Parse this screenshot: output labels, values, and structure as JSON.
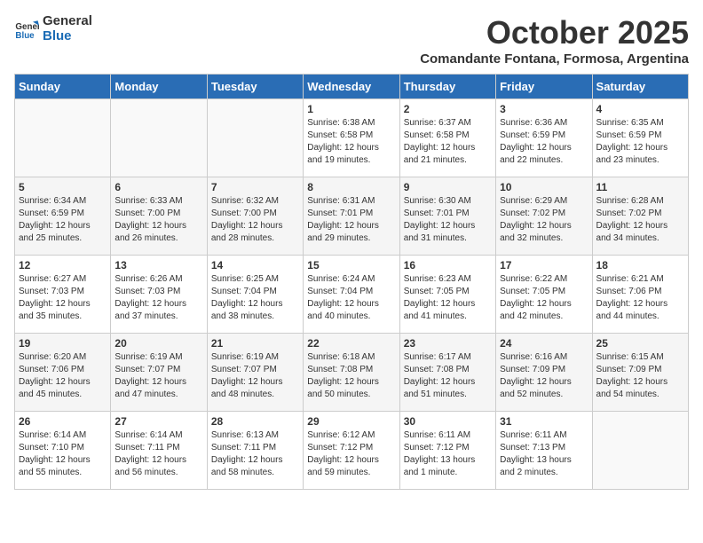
{
  "logo": {
    "line1": "General",
    "line2": "Blue"
  },
  "title": "October 2025",
  "subtitle": "Comandante Fontana, Formosa, Argentina",
  "weekdays": [
    "Sunday",
    "Monday",
    "Tuesday",
    "Wednesday",
    "Thursday",
    "Friday",
    "Saturday"
  ],
  "weeks": [
    [
      {
        "day": "",
        "info": ""
      },
      {
        "day": "",
        "info": ""
      },
      {
        "day": "",
        "info": ""
      },
      {
        "day": "1",
        "info": "Sunrise: 6:38 AM\nSunset: 6:58 PM\nDaylight: 12 hours\nand 19 minutes."
      },
      {
        "day": "2",
        "info": "Sunrise: 6:37 AM\nSunset: 6:58 PM\nDaylight: 12 hours\nand 21 minutes."
      },
      {
        "day": "3",
        "info": "Sunrise: 6:36 AM\nSunset: 6:59 PM\nDaylight: 12 hours\nand 22 minutes."
      },
      {
        "day": "4",
        "info": "Sunrise: 6:35 AM\nSunset: 6:59 PM\nDaylight: 12 hours\nand 23 minutes."
      }
    ],
    [
      {
        "day": "5",
        "info": "Sunrise: 6:34 AM\nSunset: 6:59 PM\nDaylight: 12 hours\nand 25 minutes."
      },
      {
        "day": "6",
        "info": "Sunrise: 6:33 AM\nSunset: 7:00 PM\nDaylight: 12 hours\nand 26 minutes."
      },
      {
        "day": "7",
        "info": "Sunrise: 6:32 AM\nSunset: 7:00 PM\nDaylight: 12 hours\nand 28 minutes."
      },
      {
        "day": "8",
        "info": "Sunrise: 6:31 AM\nSunset: 7:01 PM\nDaylight: 12 hours\nand 29 minutes."
      },
      {
        "day": "9",
        "info": "Sunrise: 6:30 AM\nSunset: 7:01 PM\nDaylight: 12 hours\nand 31 minutes."
      },
      {
        "day": "10",
        "info": "Sunrise: 6:29 AM\nSunset: 7:02 PM\nDaylight: 12 hours\nand 32 minutes."
      },
      {
        "day": "11",
        "info": "Sunrise: 6:28 AM\nSunset: 7:02 PM\nDaylight: 12 hours\nand 34 minutes."
      }
    ],
    [
      {
        "day": "12",
        "info": "Sunrise: 6:27 AM\nSunset: 7:03 PM\nDaylight: 12 hours\nand 35 minutes."
      },
      {
        "day": "13",
        "info": "Sunrise: 6:26 AM\nSunset: 7:03 PM\nDaylight: 12 hours\nand 37 minutes."
      },
      {
        "day": "14",
        "info": "Sunrise: 6:25 AM\nSunset: 7:04 PM\nDaylight: 12 hours\nand 38 minutes."
      },
      {
        "day": "15",
        "info": "Sunrise: 6:24 AM\nSunset: 7:04 PM\nDaylight: 12 hours\nand 40 minutes."
      },
      {
        "day": "16",
        "info": "Sunrise: 6:23 AM\nSunset: 7:05 PM\nDaylight: 12 hours\nand 41 minutes."
      },
      {
        "day": "17",
        "info": "Sunrise: 6:22 AM\nSunset: 7:05 PM\nDaylight: 12 hours\nand 42 minutes."
      },
      {
        "day": "18",
        "info": "Sunrise: 6:21 AM\nSunset: 7:06 PM\nDaylight: 12 hours\nand 44 minutes."
      }
    ],
    [
      {
        "day": "19",
        "info": "Sunrise: 6:20 AM\nSunset: 7:06 PM\nDaylight: 12 hours\nand 45 minutes."
      },
      {
        "day": "20",
        "info": "Sunrise: 6:19 AM\nSunset: 7:07 PM\nDaylight: 12 hours\nand 47 minutes."
      },
      {
        "day": "21",
        "info": "Sunrise: 6:19 AM\nSunset: 7:07 PM\nDaylight: 12 hours\nand 48 minutes."
      },
      {
        "day": "22",
        "info": "Sunrise: 6:18 AM\nSunset: 7:08 PM\nDaylight: 12 hours\nand 50 minutes."
      },
      {
        "day": "23",
        "info": "Sunrise: 6:17 AM\nSunset: 7:08 PM\nDaylight: 12 hours\nand 51 minutes."
      },
      {
        "day": "24",
        "info": "Sunrise: 6:16 AM\nSunset: 7:09 PM\nDaylight: 12 hours\nand 52 minutes."
      },
      {
        "day": "25",
        "info": "Sunrise: 6:15 AM\nSunset: 7:09 PM\nDaylight: 12 hours\nand 54 minutes."
      }
    ],
    [
      {
        "day": "26",
        "info": "Sunrise: 6:14 AM\nSunset: 7:10 PM\nDaylight: 12 hours\nand 55 minutes."
      },
      {
        "day": "27",
        "info": "Sunrise: 6:14 AM\nSunset: 7:11 PM\nDaylight: 12 hours\nand 56 minutes."
      },
      {
        "day": "28",
        "info": "Sunrise: 6:13 AM\nSunset: 7:11 PM\nDaylight: 12 hours\nand 58 minutes."
      },
      {
        "day": "29",
        "info": "Sunrise: 6:12 AM\nSunset: 7:12 PM\nDaylight: 12 hours\nand 59 minutes."
      },
      {
        "day": "30",
        "info": "Sunrise: 6:11 AM\nSunset: 7:12 PM\nDaylight: 13 hours\nand 1 minute."
      },
      {
        "day": "31",
        "info": "Sunrise: 6:11 AM\nSunset: 7:13 PM\nDaylight: 13 hours\nand 2 minutes."
      },
      {
        "day": "",
        "info": ""
      }
    ]
  ]
}
